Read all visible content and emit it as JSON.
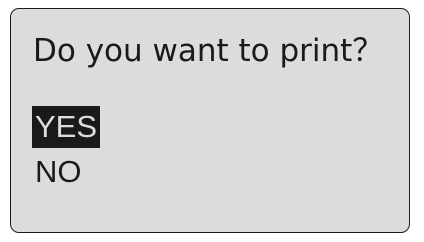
{
  "dialog": {
    "prompt": "Do you want to print？",
    "options": [
      {
        "label": "YES",
        "selected": true
      },
      {
        "label": "NO",
        "selected": false
      }
    ]
  },
  "colors": {
    "screen_background": "#dcdcdc",
    "text": "#1a1a1a",
    "highlight_background": "#1a1a1a",
    "highlight_text": "#dcdcdc"
  }
}
